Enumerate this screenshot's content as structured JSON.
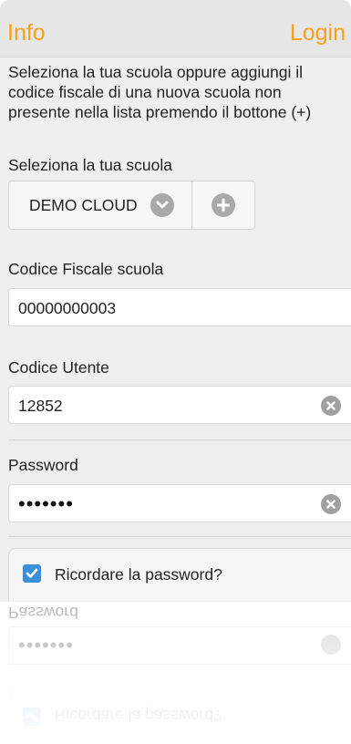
{
  "nav": {
    "left": "Info",
    "right": "Login"
  },
  "intro": "Seleziona la tua scuola oppure aggiungi il codice fiscale di una nuova scuola non presente nella lista premendo il bottone (+)",
  "school": {
    "label": "Seleziona la tua scuola",
    "selected": "DEMO CLOUD"
  },
  "fiscal": {
    "label": "Codice Fiscale scuola",
    "value": "00000000003"
  },
  "user": {
    "label": "Codice Utente",
    "value": "12852"
  },
  "password": {
    "label": "Password",
    "masked": "•••••••"
  },
  "remember": {
    "label": "Ricordare la password?",
    "checked": true
  },
  "colors": {
    "accent": "#f5a11d",
    "checkbox": "#3b8fd6"
  }
}
